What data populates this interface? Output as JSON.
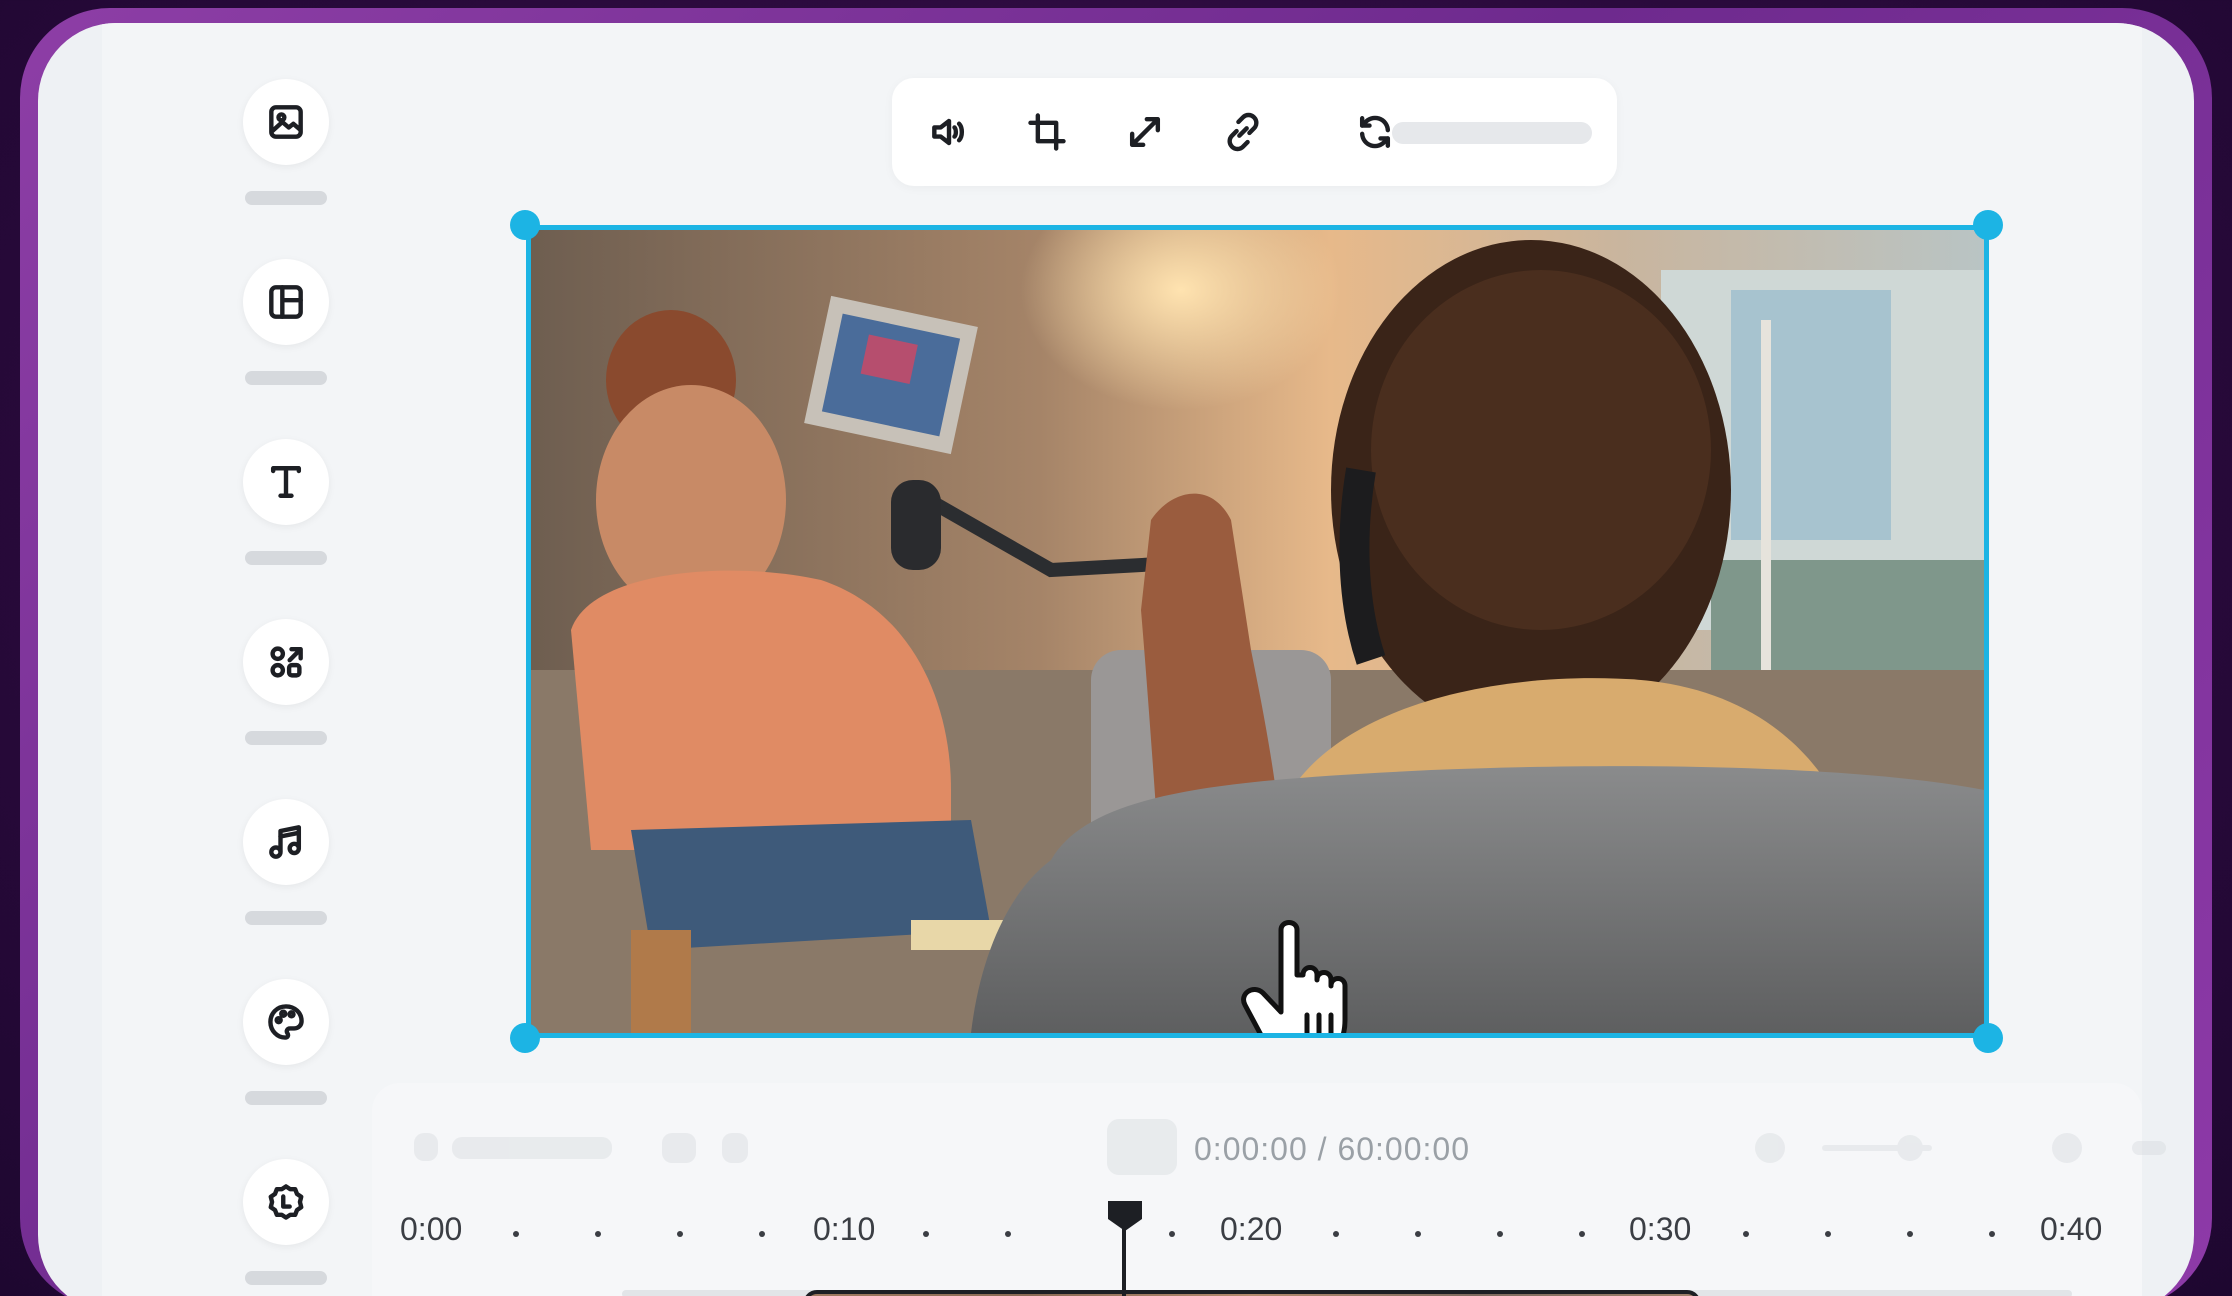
{
  "toolbar": {
    "icons": [
      "volume-icon",
      "crop-icon",
      "resize-icon",
      "link-icon",
      "replace-icon"
    ]
  },
  "sidebar": {
    "items": [
      {
        "icon": "image-icon"
      },
      {
        "icon": "layout-icon"
      },
      {
        "icon": "text-icon"
      },
      {
        "icon": "elements-icon"
      },
      {
        "icon": "music-icon"
      },
      {
        "icon": "palette-icon"
      },
      {
        "icon": "plugin-icon"
      }
    ]
  },
  "timeline": {
    "time_display": "0:00:00 / 60:00:00",
    "ruler_labels": [
      "0:00",
      "0:10",
      "0:20",
      "0:30",
      "0:40"
    ]
  },
  "colors": {
    "accent": "#1cb4e4",
    "frame": "#7a2f96",
    "background": "#2a0a3c"
  }
}
